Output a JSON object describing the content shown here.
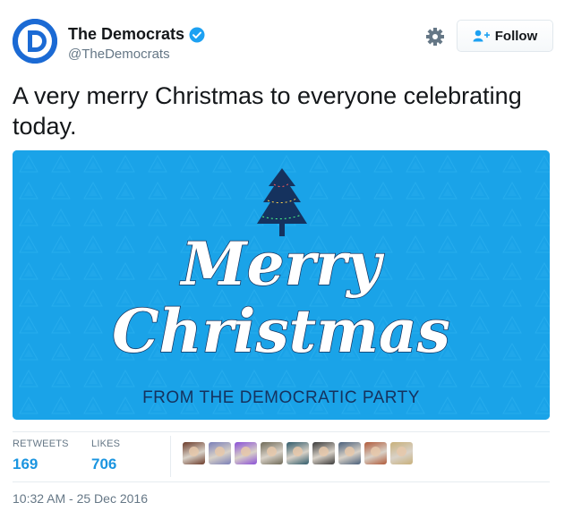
{
  "account": {
    "display_name": "The Democrats",
    "handle": "@TheDemocrats",
    "verified": true,
    "avatar_letter": "D",
    "brand_color": "#1b6ad4"
  },
  "actions": {
    "follow_label": "Follow",
    "settings_icon": "gear-icon",
    "follow_icon": "add-user-icon"
  },
  "tweet": {
    "text": "A very merry Christmas to everyone celebrating today."
  },
  "media": {
    "headline_line1": "Merry",
    "headline_line2": "Christmas",
    "caption": "FROM THE DEMOCRATIC PARTY",
    "background_color": "#1aa3e8",
    "tree_color": "#15325e"
  },
  "stats": {
    "retweets_label": "RETWEETS",
    "retweets_count": "169",
    "likes_label": "LIKES",
    "likes_count": "706",
    "liker_avatar_colors": [
      "#6b3b2a",
      "#7a7fb8",
      "#8a4fd6",
      "#6f6a58",
      "#2f5a6a",
      "#3a3a3a",
      "#4a5f7a",
      "#b05a3a",
      "#c8b07a"
    ]
  },
  "timestamp": "10:32 AM - 25 Dec 2016"
}
